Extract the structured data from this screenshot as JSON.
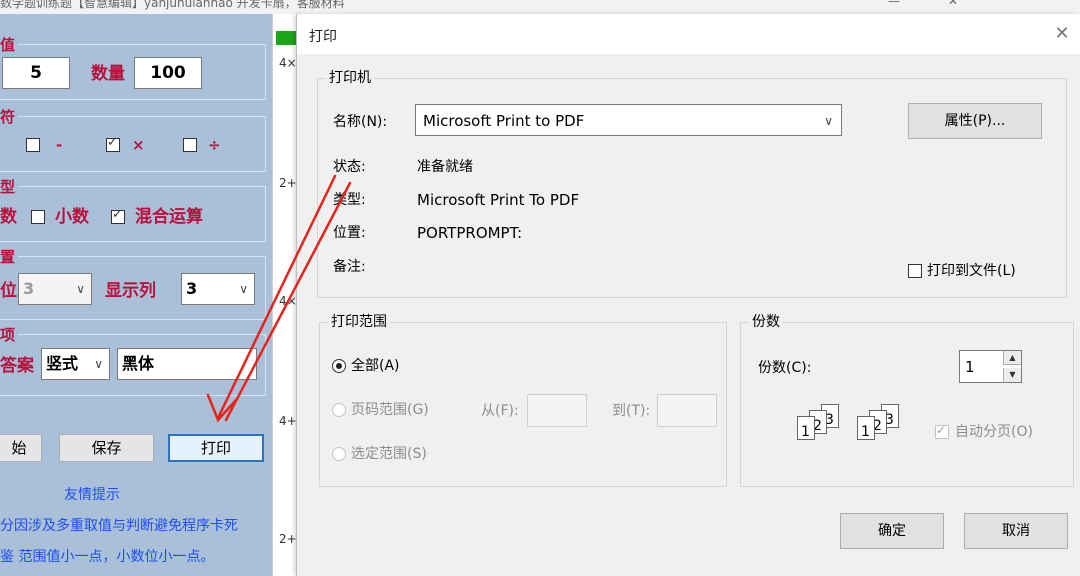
{
  "background_app": {
    "window_title": "数学题训练题【智慧编辑】yanjunulanhao 开发卡扇，客服材料",
    "groups": [
      {
        "label": "值"
      },
      {
        "label": "符"
      },
      {
        "label": "型"
      },
      {
        "label": "置"
      },
      {
        "label": "项"
      }
    ],
    "value_range": {
      "value": "5",
      "count_label": "数量",
      "count_value": "100"
    },
    "operators": [
      {
        "symbol": "-",
        "checked": false
      },
      {
        "symbol": "×",
        "checked": true
      },
      {
        "symbol": "÷",
        "checked": false
      }
    ],
    "type_row": {
      "prefix": "数",
      "decimal_label": "小数",
      "decimal_checked": false,
      "mixed_label": "混合运算",
      "mixed_checked": true
    },
    "position_row": {
      "prefix": "位",
      "digits_value": "3",
      "display_label": "显示列",
      "display_value": "3"
    },
    "options_row": {
      "answer_label": "答案",
      "answer_style": "竖式",
      "font": "黑体"
    },
    "buttons": {
      "start": "始",
      "save": "保存",
      "print": "打印"
    },
    "tips": {
      "title": "友情提示",
      "line1": "分因涉及多重取值与判断避免程序卡死",
      "line2": "鉴 范围值小一点，小数位小一点。"
    },
    "strip_labels": [
      "4×",
      "2+",
      "4×",
      "4+",
      "2+"
    ]
  },
  "dialog": {
    "title": "打印",
    "printer": {
      "section_title": "打印机",
      "name_label": "名称(N):",
      "name_value": "Microsoft Print to PDF",
      "properties_button": "属性(P)...",
      "status_label": "状态:",
      "status_value": "准备就绪",
      "type_label": "类型:",
      "type_value": "Microsoft Print To PDF",
      "location_label": "位置:",
      "location_value": "PORTPROMPT:",
      "comment_label": "备注:",
      "comment_value": "",
      "print_to_file_label": "打印到文件(L)",
      "print_to_file_checked": false
    },
    "range": {
      "section_title": "打印范围",
      "all_label": "全部(A)",
      "pages_label": "页码范围(G)",
      "from_label": "从(F):",
      "to_label": "到(T):",
      "from_value": "",
      "to_value": "",
      "selection_label": "选定范围(S)",
      "selected": "all"
    },
    "copies": {
      "section_title": "份数",
      "count_label": "份数(C):",
      "count_value": "1",
      "collate_label": "自动分页(O)",
      "collate_checked": true
    },
    "ok_button": "确定",
    "cancel_button": "取消"
  },
  "colors": {
    "panel_bg": "#aac0d9",
    "label_red": "#b8123c",
    "tip_blue": "#1b4ef0",
    "annotation_arrow": "#e8231b"
  }
}
